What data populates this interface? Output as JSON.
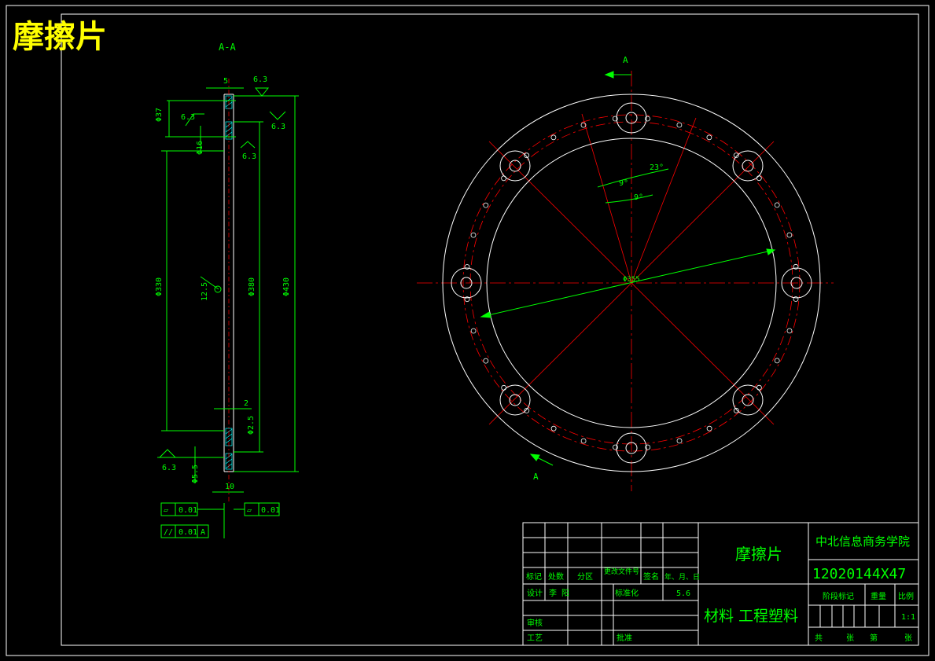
{
  "drawing": {
    "title": "摩擦片",
    "section_label": "A-A",
    "view_arrow_label_top": "A",
    "view_arrow_label_bottom": "A",
    "colors": {
      "background": "#000000",
      "frame": "#ffffff",
      "dimension": "#00ff00",
      "centerline": "#ff0000",
      "title": "#ffff00",
      "hatch": "#00ffff"
    },
    "section_dims": {
      "width_top": "5",
      "roughness_top": "6.3",
      "roughness_left": "6.3",
      "roughness_right": "6.3",
      "roughness_mid": "6.3",
      "roughness_bottom": "6.3",
      "roughness_center": "12.5",
      "dim_phi37": "Φ37",
      "dim_phi16": "Φ16",
      "dim_phi330": "Φ330",
      "dim_phi380": "Φ380",
      "dim_phi430": "Φ430",
      "dim_2": "2",
      "dim_phi2_5": "Φ2.5",
      "dim_phi5_5": "Φ5.5",
      "dim_10": "10"
    },
    "tolerances": [
      {
        "symbol": "▱",
        "value": "0.01",
        "datum": ""
      },
      {
        "symbol": "//",
        "value": "0.01",
        "datum": "A"
      },
      {
        "symbol": "▱",
        "value": "0.01",
        "datum": ""
      }
    ],
    "plan_dims": {
      "angle_23": "23°",
      "angle_9a": "9°",
      "angle_9b": "9°",
      "dim_phi355": "Φ355"
    }
  },
  "title_block": {
    "part_name": "摩擦片",
    "school": "中北信息商务学院",
    "drawing_number": "12020144X47",
    "material": "材料 工程塑料",
    "row_labels": [
      "标记",
      "处数",
      "分区",
      "更改文件号",
      "签名",
      "年、月、日"
    ],
    "design_label": "设计",
    "designer": "李 阳",
    "standardize_label": "标准化",
    "date": "5.6",
    "review_label": "审核",
    "process_label": "工艺",
    "approve_label": "批准",
    "stage_label": "阶段标记",
    "weight_label": "重量",
    "scale_label": "比例",
    "scale_value": "1:1",
    "sheet_total": "共",
    "sheet_of": "张",
    "sheet_num": "第",
    "sheet_of2": "张"
  }
}
